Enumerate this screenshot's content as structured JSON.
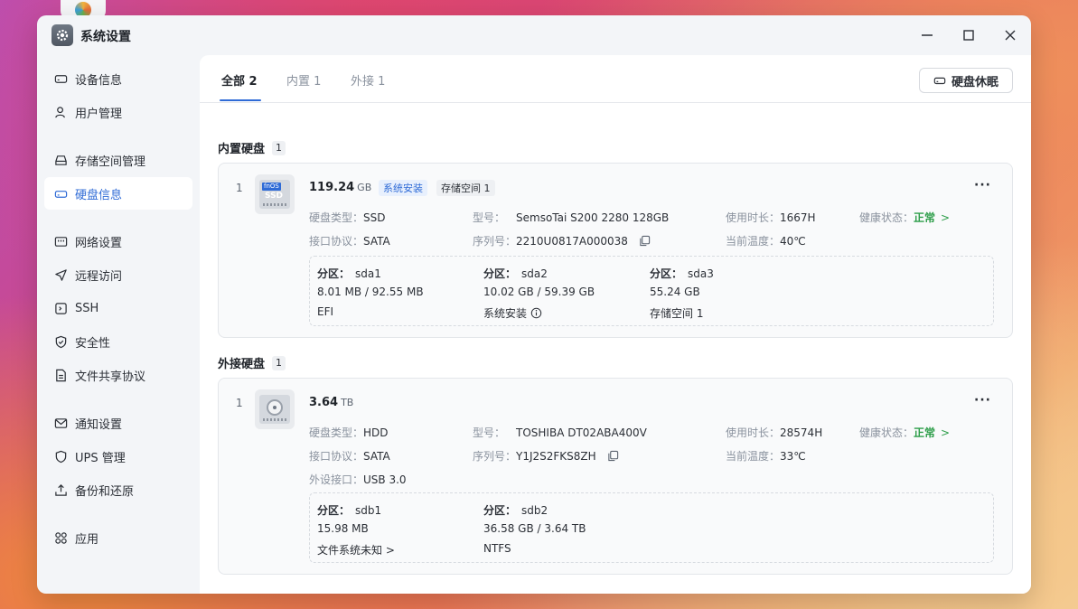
{
  "window": {
    "title": "系统设置"
  },
  "sidebar": {
    "items": [
      {
        "label": "设备信息",
        "icon": "device-icon"
      },
      {
        "label": "用户管理",
        "icon": "user-icon"
      },
      {
        "label": "存储空间管理",
        "icon": "storage-icon"
      },
      {
        "label": "硬盘信息",
        "icon": "disk-icon",
        "active": true
      },
      {
        "label": "网络设置",
        "icon": "network-icon"
      },
      {
        "label": "远程访问",
        "icon": "send-icon"
      },
      {
        "label": "SSH",
        "icon": "terminal-icon"
      },
      {
        "label": "安全性",
        "icon": "shield-check-icon"
      },
      {
        "label": "文件共享协议",
        "icon": "file-icon"
      },
      {
        "label": "通知设置",
        "icon": "mail-icon"
      },
      {
        "label": "UPS 管理",
        "icon": "shield-icon"
      },
      {
        "label": "备份和还原",
        "icon": "backup-icon"
      },
      {
        "label": "应用",
        "icon": "apps-icon"
      }
    ]
  },
  "tabs": [
    {
      "label": "全部 2",
      "active": true
    },
    {
      "label": "内置 1"
    },
    {
      "label": "外接 1"
    }
  ],
  "toolbar": {
    "sleep_label": "硬盘休眠"
  },
  "internal": {
    "title": "内置硬盘",
    "count": "1",
    "disk": {
      "index": "1",
      "icon_badge": "fnOS",
      "icon_label": "SSD",
      "capacity": "119.24",
      "capacity_unit": "GB",
      "tags": [
        "系统安装",
        "存储空间 1"
      ],
      "type_key": "硬盘类型：",
      "type_val": "SSD",
      "model_key": "型号：",
      "model_val": "SemsoTai S200 2280 128GB",
      "hours_key": "使用时长：",
      "hours_val": "1667H",
      "health_key": "健康状态：",
      "health_val": "正常",
      "iface_key": "接口协议：",
      "iface_val": "SATA",
      "serial_key": "序列号：",
      "serial_val": "2210U0817A000038",
      "temp_key": "当前温度：",
      "temp_val": "40℃",
      "partitions": [
        {
          "key": "分区：",
          "name": "sda1",
          "size": "8.01 MB / 92.55 MB",
          "desc": "EFI"
        },
        {
          "key": "分区：",
          "name": "sda2",
          "size": "10.02 GB / 59.39 GB",
          "desc": "系统安装"
        },
        {
          "key": "分区：",
          "name": "sda3",
          "size": "55.24 GB",
          "desc": "存储空间 1"
        }
      ]
    }
  },
  "external": {
    "title": "外接硬盘",
    "count": "1",
    "disk": {
      "index": "1",
      "capacity": "3.64",
      "capacity_unit": "TB",
      "type_key": "硬盘类型：",
      "type_val": "HDD",
      "model_key": "型号：",
      "model_val": "TOSHIBA DT02ABA400V",
      "hours_key": "使用时长：",
      "hours_val": "28574H",
      "health_key": "健康状态：",
      "health_val": "正常",
      "iface_key": "接口协议：",
      "iface_val": "SATA",
      "serial_key": "序列号：",
      "serial_val": "Y1J2S2FKS8ZH",
      "temp_key": "当前温度：",
      "temp_val": "33℃",
      "port_key": "外设接口：",
      "port_val": "USB 3.0",
      "partitions": [
        {
          "key": "分区：",
          "name": "sdb1",
          "size": "15.98 MB",
          "desc": "文件系统未知 >"
        },
        {
          "key": "分区：",
          "name": "sdb2",
          "size": "36.58 GB / 3.64 TB",
          "desc": "NTFS"
        }
      ]
    }
  },
  "colors": {
    "accent": "#2f6bd6",
    "ok": "#2e9e4a"
  }
}
